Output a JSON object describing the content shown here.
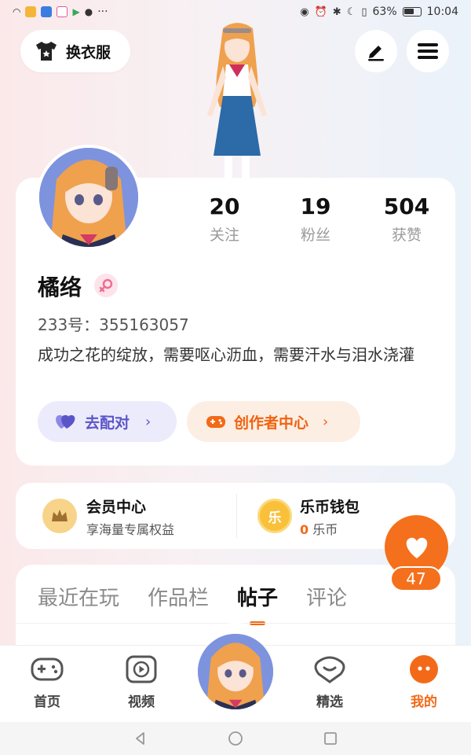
{
  "status_bar": {
    "battery": "63%",
    "time": "10:04",
    "ellipsis": "···"
  },
  "header": {
    "outfit_label": "换衣服"
  },
  "profile": {
    "stats": [
      {
        "value": "20",
        "label": "关注"
      },
      {
        "value": "19",
        "label": "粉丝"
      },
      {
        "value": "504",
        "label": "获赞"
      }
    ],
    "username": "橘络",
    "uid": "233号：355163057",
    "bio": "成功之花的绽放，需要呕心沥血，需要汗水与泪水浇灌",
    "match_label": "去配对",
    "creator_label": "创作者中心"
  },
  "vip": {
    "title": "会员中心",
    "subtitle": "享海量专属权益"
  },
  "wallet": {
    "title": "乐币钱包",
    "coin_glyph": "乐",
    "balance": "0",
    "unit": "乐币"
  },
  "likes": {
    "count": "47"
  },
  "tabs": [
    {
      "label": "最近在玩",
      "active": false
    },
    {
      "label": "作品栏",
      "active": false
    },
    {
      "label": "帖子",
      "active": true
    },
    {
      "label": "评论",
      "active": false
    }
  ],
  "bottom_nav": [
    {
      "label": "首页",
      "icon": "gamepad-icon"
    },
    {
      "label": "视频",
      "icon": "video-icon"
    },
    {
      "label": "精选",
      "icon": "heart-chat-icon"
    },
    {
      "label": "我的",
      "icon": "profile-face-icon",
      "active": true
    }
  ],
  "colors": {
    "accent": "#f26a17",
    "match": "#5b55c8",
    "match_bg": "#ecebfb",
    "creator_bg": "#fdeee4"
  }
}
